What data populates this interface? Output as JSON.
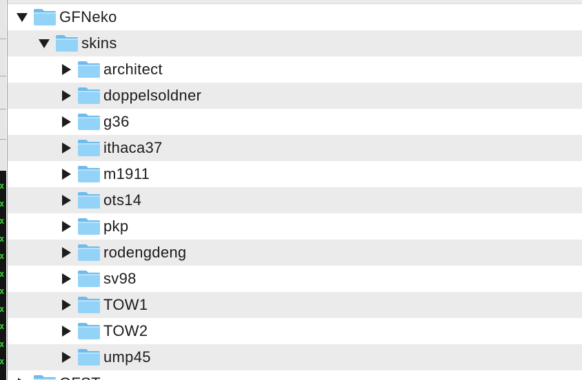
{
  "colors": {
    "row_alt": "#ebebeb",
    "folder_body": "#8fd0f7",
    "folder_tab": "#7cc3ee",
    "text": "#1b1b1b",
    "terminal_bg": "#141414",
    "terminal_mark": "#39d639"
  },
  "icons": {
    "expanded": "disclosure-triangle-down-icon",
    "collapsed": "disclosure-triangle-right-icon",
    "folder": "folder-icon"
  },
  "tree": {
    "root": {
      "label": "GFNeko",
      "expanded": true
    },
    "skins": {
      "label": "skins",
      "expanded": true
    },
    "children": [
      {
        "label": "architect",
        "expanded": false
      },
      {
        "label": "doppelsoldner",
        "expanded": false
      },
      {
        "label": "g36",
        "expanded": false
      },
      {
        "label": "ithaca37",
        "expanded": false
      },
      {
        "label": "m1911",
        "expanded": false
      },
      {
        "label": "ots14",
        "expanded": false
      },
      {
        "label": "pkp",
        "expanded": false
      },
      {
        "label": "rodengdeng",
        "expanded": false
      },
      {
        "label": "sv98",
        "expanded": false
      },
      {
        "label": "TOW1",
        "expanded": false
      },
      {
        "label": "TOW2",
        "expanded": false
      },
      {
        "label": "ump45",
        "expanded": false
      }
    ],
    "next_sibling": {
      "label": "GFST",
      "expanded": false
    }
  },
  "background_window": {
    "terminal_marks": [
      "x",
      "x",
      "x",
      "x",
      "x",
      "x",
      "x",
      "x",
      "x",
      "x",
      "x"
    ]
  }
}
